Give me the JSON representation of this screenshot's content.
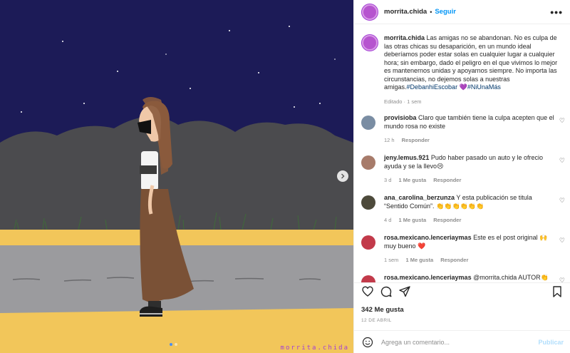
{
  "post": {
    "username": "morrita.chida",
    "follow_label": "Seguir",
    "more_label": "•••",
    "caption_before": "Las amigas no se abandonan. No es culpa de las otras chicas su desaparición, en un mundo ideal deberíamos poder estar solas en cualquier lugar a cualquier hora; sin embargo, dado el peligro en el que vivimos lo mejor es mantenernos unidas y apoyarnos siempre. No importa las circunstancias, no dejemos solas a nuestras amigas.",
    "hashtag1": "#DebanhiEscobar",
    "heart": "💜",
    "hashtag2": "#NiUnaMás",
    "caption_meta": "Editado · 1 sem",
    "watermark": "morrita.chida"
  },
  "comments": [
    {
      "user": "provisioba",
      "text": "Claro que también tiene la culpa acepten que el mundo rosa no existe",
      "time": "12 h",
      "likes": "",
      "reply": "Responder",
      "avatar_color": "#7a8da3"
    },
    {
      "user": "jeny.lemus.921",
      "text": "Pudo haber pasado un auto y le ofrecio ayuda y se la llevo😢",
      "time": "3 d",
      "likes": "1 Me gusta",
      "reply": "Responder",
      "avatar_color": "#a77b6a"
    },
    {
      "user": "ana_carolina_berzunza",
      "text": "Y esta publicación se titula “Sentido Común”. 👏👏👏👏👏👏",
      "time": "4 d",
      "likes": "1 Me gusta",
      "reply": "Responder",
      "avatar_color": "#4d4a3b"
    },
    {
      "user": "rosa.mexicano.lenceriaymas",
      "text": "Este es el post original 🙌 muy bueno ❤️",
      "time": "1 sem",
      "likes": "1 Me gusta",
      "reply": "Responder",
      "avatar_color": "#c23a4a"
    },
    {
      "user": "rosa.mexicano.lenceriaymas",
      "text": "@morrita.chida AUTOR👏👏",
      "time": "",
      "likes": "",
      "reply": "",
      "avatar_color": "#c23a4a"
    }
  ],
  "stats": {
    "likes": "342 Me gusta",
    "date": "12 DE ABRIL"
  },
  "add_comment": {
    "placeholder": "Agrega un comentario...",
    "publish": "Publicar"
  },
  "colors": {
    "sky": "#1b1a55",
    "accent": "#0095f6",
    "brand_purple": "#a33fd6"
  }
}
